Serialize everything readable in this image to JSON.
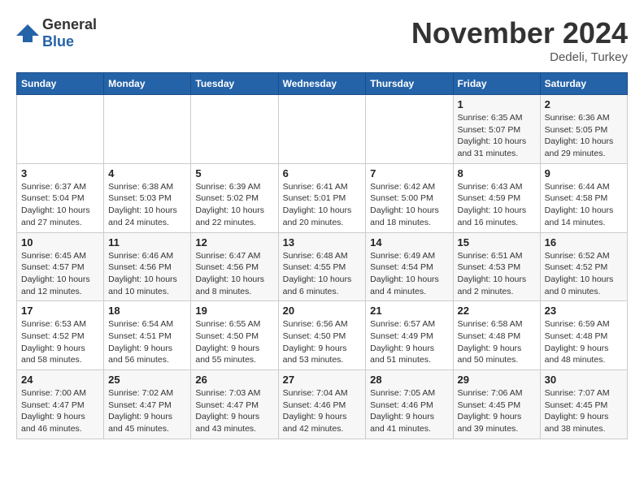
{
  "logo": {
    "general": "General",
    "blue": "Blue"
  },
  "header": {
    "month_title": "November 2024",
    "location": "Dedeli, Turkey"
  },
  "days_of_week": [
    "Sunday",
    "Monday",
    "Tuesday",
    "Wednesday",
    "Thursday",
    "Friday",
    "Saturday"
  ],
  "weeks": [
    [
      {
        "day": "",
        "info": ""
      },
      {
        "day": "",
        "info": ""
      },
      {
        "day": "",
        "info": ""
      },
      {
        "day": "",
        "info": ""
      },
      {
        "day": "",
        "info": ""
      },
      {
        "day": "1",
        "info": "Sunrise: 6:35 AM\nSunset: 5:07 PM\nDaylight: 10 hours and 31 minutes."
      },
      {
        "day": "2",
        "info": "Sunrise: 6:36 AM\nSunset: 5:05 PM\nDaylight: 10 hours and 29 minutes."
      }
    ],
    [
      {
        "day": "3",
        "info": "Sunrise: 6:37 AM\nSunset: 5:04 PM\nDaylight: 10 hours and 27 minutes."
      },
      {
        "day": "4",
        "info": "Sunrise: 6:38 AM\nSunset: 5:03 PM\nDaylight: 10 hours and 24 minutes."
      },
      {
        "day": "5",
        "info": "Sunrise: 6:39 AM\nSunset: 5:02 PM\nDaylight: 10 hours and 22 minutes."
      },
      {
        "day": "6",
        "info": "Sunrise: 6:41 AM\nSunset: 5:01 PM\nDaylight: 10 hours and 20 minutes."
      },
      {
        "day": "7",
        "info": "Sunrise: 6:42 AM\nSunset: 5:00 PM\nDaylight: 10 hours and 18 minutes."
      },
      {
        "day": "8",
        "info": "Sunrise: 6:43 AM\nSunset: 4:59 PM\nDaylight: 10 hours and 16 minutes."
      },
      {
        "day": "9",
        "info": "Sunrise: 6:44 AM\nSunset: 4:58 PM\nDaylight: 10 hours and 14 minutes."
      }
    ],
    [
      {
        "day": "10",
        "info": "Sunrise: 6:45 AM\nSunset: 4:57 PM\nDaylight: 10 hours and 12 minutes."
      },
      {
        "day": "11",
        "info": "Sunrise: 6:46 AM\nSunset: 4:56 PM\nDaylight: 10 hours and 10 minutes."
      },
      {
        "day": "12",
        "info": "Sunrise: 6:47 AM\nSunset: 4:56 PM\nDaylight: 10 hours and 8 minutes."
      },
      {
        "day": "13",
        "info": "Sunrise: 6:48 AM\nSunset: 4:55 PM\nDaylight: 10 hours and 6 minutes."
      },
      {
        "day": "14",
        "info": "Sunrise: 6:49 AM\nSunset: 4:54 PM\nDaylight: 10 hours and 4 minutes."
      },
      {
        "day": "15",
        "info": "Sunrise: 6:51 AM\nSunset: 4:53 PM\nDaylight: 10 hours and 2 minutes."
      },
      {
        "day": "16",
        "info": "Sunrise: 6:52 AM\nSunset: 4:52 PM\nDaylight: 10 hours and 0 minutes."
      }
    ],
    [
      {
        "day": "17",
        "info": "Sunrise: 6:53 AM\nSunset: 4:52 PM\nDaylight: 9 hours and 58 minutes."
      },
      {
        "day": "18",
        "info": "Sunrise: 6:54 AM\nSunset: 4:51 PM\nDaylight: 9 hours and 56 minutes."
      },
      {
        "day": "19",
        "info": "Sunrise: 6:55 AM\nSunset: 4:50 PM\nDaylight: 9 hours and 55 minutes."
      },
      {
        "day": "20",
        "info": "Sunrise: 6:56 AM\nSunset: 4:50 PM\nDaylight: 9 hours and 53 minutes."
      },
      {
        "day": "21",
        "info": "Sunrise: 6:57 AM\nSunset: 4:49 PM\nDaylight: 9 hours and 51 minutes."
      },
      {
        "day": "22",
        "info": "Sunrise: 6:58 AM\nSunset: 4:48 PM\nDaylight: 9 hours and 50 minutes."
      },
      {
        "day": "23",
        "info": "Sunrise: 6:59 AM\nSunset: 4:48 PM\nDaylight: 9 hours and 48 minutes."
      }
    ],
    [
      {
        "day": "24",
        "info": "Sunrise: 7:00 AM\nSunset: 4:47 PM\nDaylight: 9 hours and 46 minutes."
      },
      {
        "day": "25",
        "info": "Sunrise: 7:02 AM\nSunset: 4:47 PM\nDaylight: 9 hours and 45 minutes."
      },
      {
        "day": "26",
        "info": "Sunrise: 7:03 AM\nSunset: 4:47 PM\nDaylight: 9 hours and 43 minutes."
      },
      {
        "day": "27",
        "info": "Sunrise: 7:04 AM\nSunset: 4:46 PM\nDaylight: 9 hours and 42 minutes."
      },
      {
        "day": "28",
        "info": "Sunrise: 7:05 AM\nSunset: 4:46 PM\nDaylight: 9 hours and 41 minutes."
      },
      {
        "day": "29",
        "info": "Sunrise: 7:06 AM\nSunset: 4:45 PM\nDaylight: 9 hours and 39 minutes."
      },
      {
        "day": "30",
        "info": "Sunrise: 7:07 AM\nSunset: 4:45 PM\nDaylight: 9 hours and 38 minutes."
      }
    ]
  ]
}
